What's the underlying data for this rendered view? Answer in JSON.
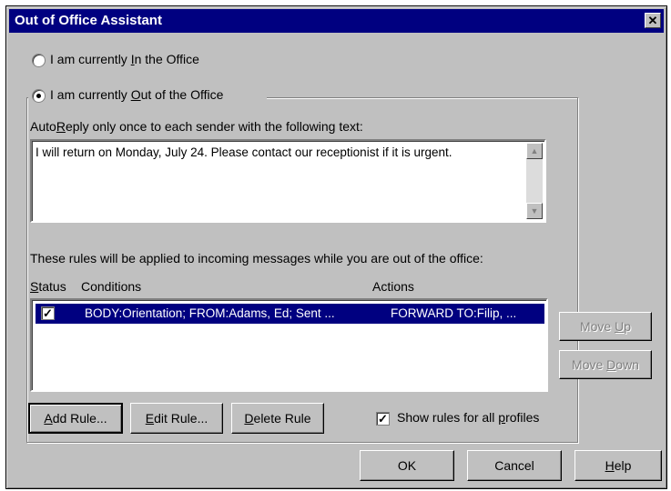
{
  "dialog": {
    "title": "Out of Office Assistant",
    "close_glyph": "✕"
  },
  "radios": {
    "in_office": {
      "pre": "I am currently ",
      "u": "I",
      "post": "n the Office",
      "checked": false
    },
    "out_office": {
      "pre": "I am currently ",
      "u": "O",
      "post": "ut of the Office",
      "checked": true
    }
  },
  "autoreply": {
    "label_pre": "Auto",
    "label_u": "R",
    "label_post": "eply only once to each sender with the following text:",
    "text": "I will return on Monday, July 24.  Please contact our receptionist if it is urgent."
  },
  "rules": {
    "intro": "These rules will be applied to incoming messages while you are out of the office:",
    "col_status_u": "S",
    "col_status_rest": "tatus",
    "col_conditions": "Conditions",
    "col_actions": "Actions",
    "rows": [
      {
        "checked": true,
        "conditions": "BODY:Orientation; FROM:Adams, Ed; Sent ...",
        "actions": "FORWARD TO:Filip, ..."
      }
    ]
  },
  "buttons": {
    "move_up": {
      "pre": "Move ",
      "u": "U",
      "post": "p"
    },
    "move_down": {
      "pre": "Move ",
      "u": "D",
      "post": "own"
    },
    "add_rule": {
      "pre": "",
      "u": "A",
      "post": "dd Rule..."
    },
    "edit_rule": {
      "pre": "",
      "u": "E",
      "post": "dit Rule..."
    },
    "delete_rule": {
      "pre": "",
      "u": "D",
      "post": "elete Rule"
    },
    "ok": "OK",
    "cancel": "Cancel",
    "help": {
      "pre": "",
      "u": "H",
      "post": "elp"
    }
  },
  "show_all": {
    "pre": "Show rules for all ",
    "u": "p",
    "post": "rofiles",
    "checked": true
  },
  "colors": {
    "titlebar": "#000080",
    "face": "#c0c0c0",
    "selection": "#000080"
  }
}
